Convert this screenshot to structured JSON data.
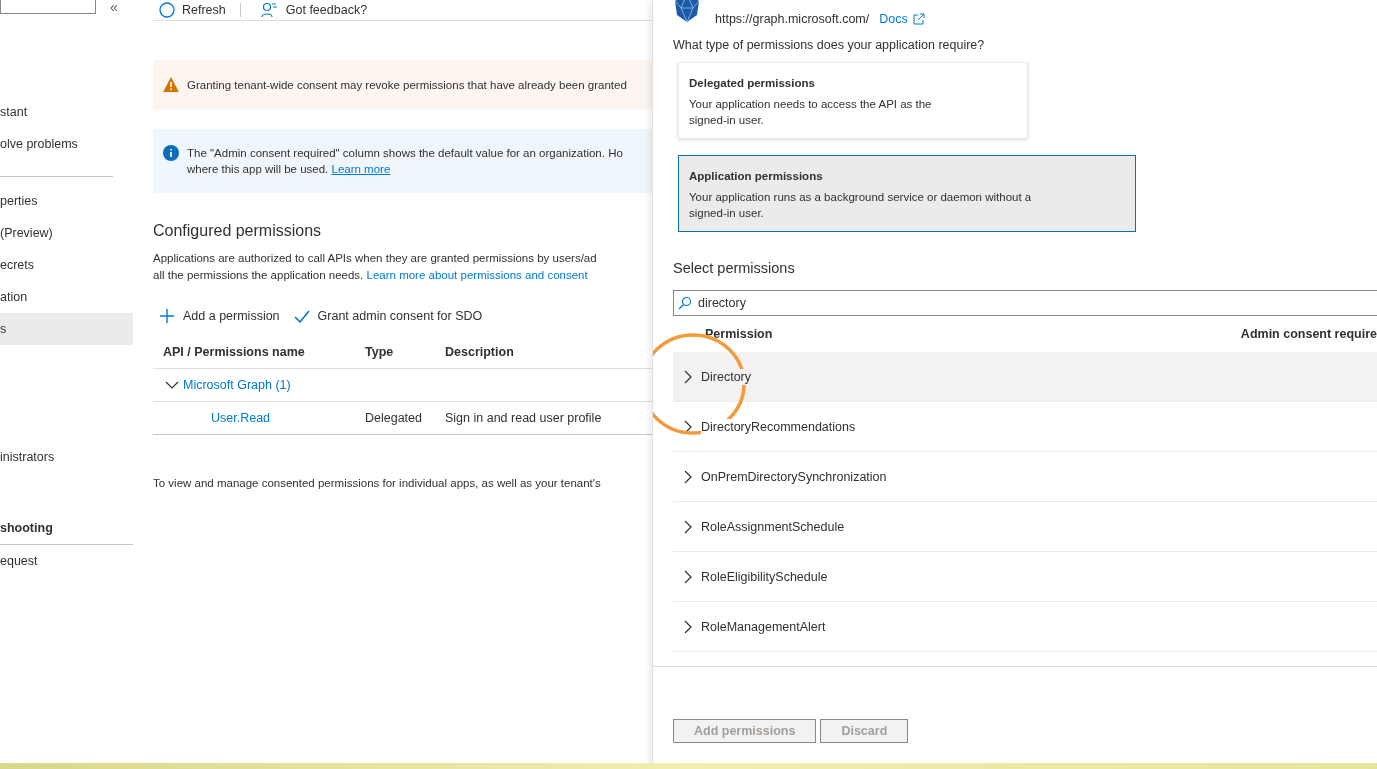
{
  "sidebar": {
    "collapse": "«",
    "items": [
      {
        "kind": "item",
        "label": "stant",
        "selected": false
      },
      {
        "kind": "item",
        "label": "olve problems",
        "selected": false
      },
      {
        "kind": "item",
        "label": "perties",
        "selected": false
      },
      {
        "kind": "item",
        "label": "(Preview)",
        "selected": false
      },
      {
        "kind": "item",
        "label": "ecrets",
        "selected": false
      },
      {
        "kind": "item",
        "label": "ation",
        "selected": false
      },
      {
        "kind": "item",
        "label": "s",
        "selected": true
      },
      {
        "kind": "item",
        "label": "inistrators",
        "selected": false
      },
      {
        "kind": "heading",
        "label": "shooting",
        "selected": false
      },
      {
        "kind": "item",
        "label": "equest",
        "selected": false
      }
    ]
  },
  "toolbar": [
    {
      "kind": "refresh",
      "label": "Refresh"
    },
    {
      "kind": "feedback",
      "label": "Got feedback?"
    }
  ],
  "warning": {
    "text": "Granting tenant-wide consent may revoke permissions that have already been granted"
  },
  "info": {
    "lines": [
      "The \"Admin consent required\" column shows the default value for an organization. Ho",
      "where this app will be used."
    ],
    "link": "Learn more"
  },
  "configured": {
    "title": "Configured permissions",
    "lines": [
      "Applications are authorized to call APIs when they are granted permissions by users/ad",
      "all the permissions the application needs."
    ],
    "link": "Learn more about permissions and consent"
  },
  "actions": [
    {
      "kind": "add",
      "label": "Add a permission"
    },
    {
      "kind": "grant",
      "label": "Grant admin consent for SDO"
    }
  ],
  "table": {
    "columns": [
      "API / Permissions name",
      "Type",
      "Description"
    ],
    "groups": [
      {
        "label": "Microsoft Graph (1)",
        "expanded": true,
        "rows": [
          {
            "name": "User.Read",
            "type": "Delegated",
            "description": "Sign in and read user profile"
          }
        ]
      }
    ]
  },
  "footer_text": "To view and manage consented permissions for individual apps, as well as your tenant's",
  "panel": {
    "api_url": "https://graph.microsoft.com/",
    "docs_link": "Docs",
    "question": "What type of permissions does your application require?",
    "types": [
      {
        "title": "Delegated permissions",
        "description": "Your application needs to access the API as the signed-in user.",
        "selected": false
      },
      {
        "title": "Application permissions",
        "description": "Your application runs as a background service or daemon without a signed-in user.",
        "selected": true
      }
    ],
    "select_title": "Select permissions",
    "search": {
      "value": "directory"
    },
    "columns": [
      "Permission",
      "Admin consent require"
    ],
    "permissions": [
      {
        "label": "Directory",
        "expanded": false,
        "highlighted": true
      },
      {
        "label": "DirectoryRecommendations",
        "expanded": false,
        "highlighted": false
      },
      {
        "label": "OnPremDirectorySynchronization",
        "expanded": false,
        "highlighted": false
      },
      {
        "label": "RoleAssignmentSchedule",
        "expanded": false,
        "highlighted": false
      },
      {
        "label": "RoleEligibilitySchedule",
        "expanded": false,
        "highlighted": false
      },
      {
        "label": "RoleManagementAlert",
        "expanded": false,
        "highlighted": false
      }
    ],
    "buttons": [
      {
        "label": "Add permissions",
        "disabled": true
      },
      {
        "label": "Discard",
        "disabled": true
      }
    ]
  }
}
